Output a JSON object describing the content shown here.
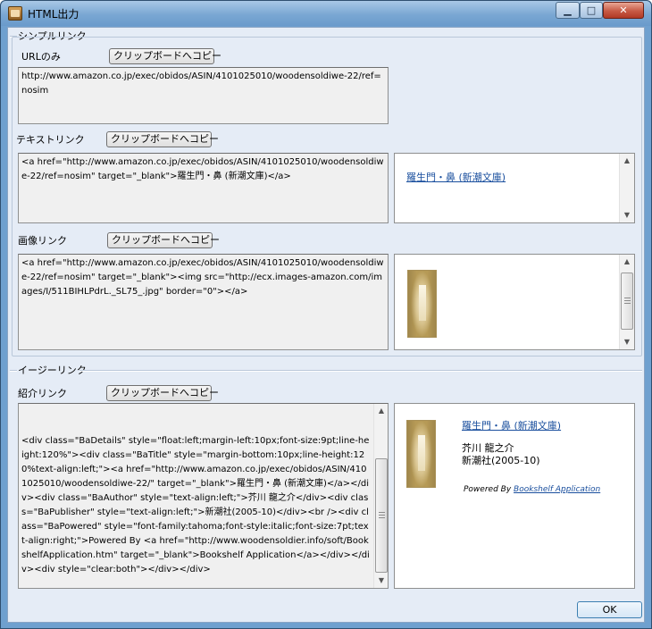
{
  "window": {
    "title": "HTML出力",
    "minimize_glyph": "▁",
    "maximize_glyph": "□",
    "close_glyph": "✕",
    "icon": "app-book-icon"
  },
  "simple_link": {
    "group_title": "シンプルリンク",
    "url_only": {
      "label": "URLのみ",
      "copy_button": "クリップボードへコピー",
      "text": "http://www.amazon.co.jp/exec/obidos/ASIN/4101025010/woodensoldiwe-22/ref=nosim"
    },
    "text_link": {
      "label": "テキストリンク",
      "copy_button": "クリップボードへコピー",
      "text": "<a href=\"http://www.amazon.co.jp/exec/obidos/ASIN/4101025010/woodensoldiwe-22/ref=nosim\" target=\"_blank\">羅生門・鼻 (新潮文庫)</a>",
      "preview_link": "羅生門・鼻 (新潮文庫)"
    },
    "image_link": {
      "label": "画像リンク",
      "copy_button": "クリップボードへコピー",
      "text": "<a href=\"http://www.amazon.co.jp/exec/obidos/ASIN/4101025010/woodensoldiwe-22/ref=nosim\" target=\"_blank\"><img src=\"http://ecx.images-amazon.com/images/I/511BIHLPdrL._SL75_.jpg\" border=\"0\"></a>"
    }
  },
  "easy_link": {
    "group_title": "イージーリンク",
    "intro_link": {
      "label": "紹介リンク",
      "copy_button": "クリップボードへコピー",
      "text": "<div class=\"BaDetails\" style=\"float:left;margin-left:10px;font-size:9pt;line-height:120%\"><div class=\"BaTitle\" style=\"margin-bottom:10px;line-height:120%text-align:left;\"><a href=\"http://www.amazon.co.jp/exec/obidos/ASIN/4101025010/woodensoldiwe-22/\" target=\"_blank\">羅生門・鼻 (新潮文庫)</a></div><div class=\"BaAuthor\" style=\"text-align:left;\">芥川 龍之介</div><div class=\"BaPublisher\" style=\"text-align:left;\">新潮社(2005-10)</div><br /><div class=\"BaPowered\" style=\"font-family:tahoma;font-style:italic;font-size:7pt;text-align:right;\">Powered By <a href=\"http://www.woodensoldier.info/soft/BookshelfApplication.htm\" target=\"_blank\">Bookshelf Application</a></div></div><div style=\"clear:both\"></div></div>",
      "preview": {
        "title": "羅生門・鼻 (新潮文庫)",
        "author": "芥川 龍之介",
        "publisher": "新潮社(2005-10)",
        "powered_by": "Powered By",
        "powered_link": "Bookshelf Application"
      }
    }
  },
  "footer": {
    "ok_button": "OK"
  }
}
